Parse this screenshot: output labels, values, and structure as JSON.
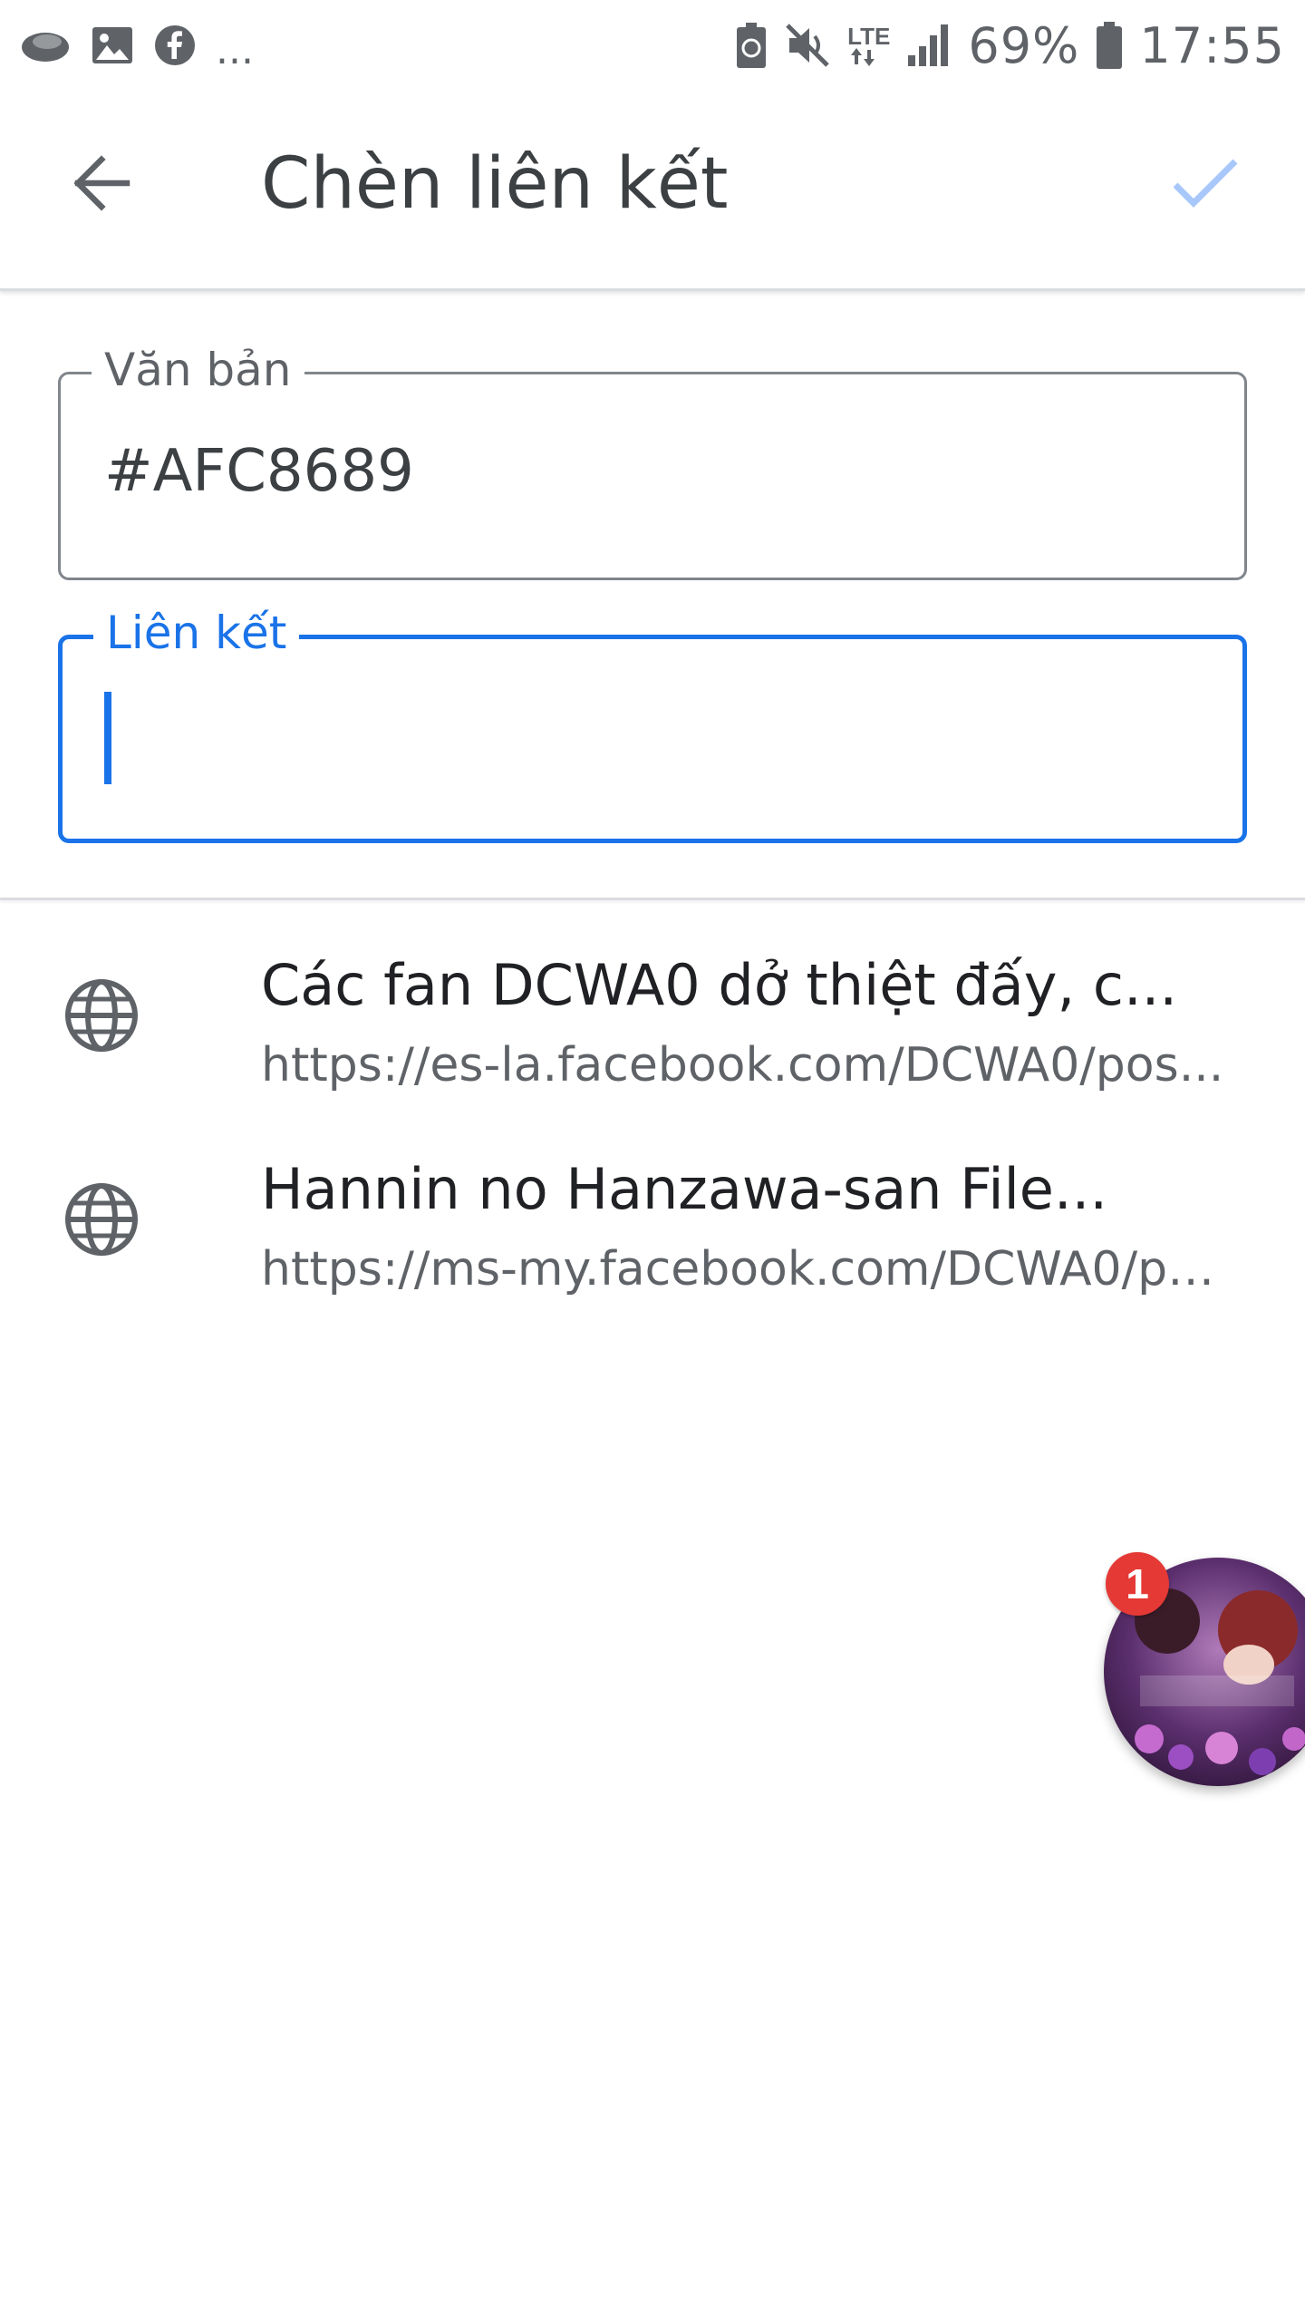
{
  "status_bar": {
    "notification_icons": [
      "cloud-icon",
      "image-icon",
      "facebook-icon"
    ],
    "more_indicator": "...",
    "network_type": "LTE",
    "battery_percent": "69%",
    "time": "17:55"
  },
  "toolbar": {
    "back_icon": "arrow-back-icon",
    "title": "Chèn liên kết",
    "confirm_icon": "check-icon",
    "confirm_color": "#a8c7fa"
  },
  "form": {
    "text_field": {
      "label": "Văn bản",
      "value": "#AFC8689"
    },
    "link_field": {
      "label": "Liên kết",
      "value": "",
      "focused": true,
      "accent_color": "#1a73e8"
    }
  },
  "suggestions": [
    {
      "icon": "globe-icon",
      "title": "Các fan DCWA0 dở thiệt đấy, c...",
      "url": "https://es-la.facebook.com/DCWA0/pos..."
    },
    {
      "icon": "globe-icon",
      "title": "Hannin no Hanzawa-san   File...",
      "url": "https://ms-my.facebook.com/DCWA0/po..."
    }
  ],
  "chat_head": {
    "badge_count": "1",
    "badge_color": "#e53935"
  }
}
